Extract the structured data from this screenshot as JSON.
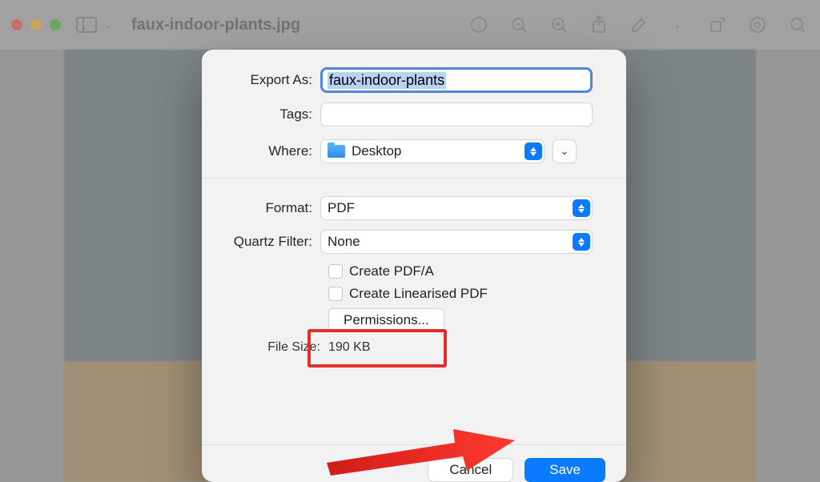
{
  "window": {
    "title": "faux-indoor-plants.jpg"
  },
  "dialog": {
    "export_as": {
      "label": "Export As:",
      "value": "faux-indoor-plants"
    },
    "tags": {
      "label": "Tags:"
    },
    "where": {
      "label": "Where:",
      "value": "Desktop"
    },
    "format": {
      "label": "Format:",
      "value": "PDF"
    },
    "quartz": {
      "label": "Quartz Filter:",
      "value": "None"
    },
    "opt_pdfa": "Create PDF/A",
    "opt_linear": "Create Linearised PDF",
    "permissions": "Permissions...",
    "file_size": {
      "label": "File Size:",
      "value": "190 KB"
    },
    "cancel": "Cancel",
    "save": "Save"
  }
}
